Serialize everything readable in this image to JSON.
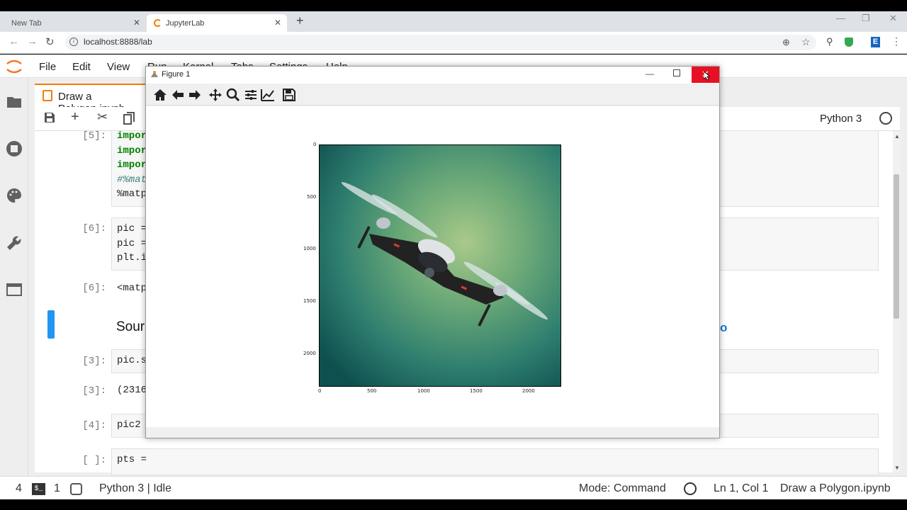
{
  "browser": {
    "tabs": [
      {
        "label": "New Tab",
        "close": "✕"
      },
      {
        "label": "JupyterLab",
        "close": "✕"
      }
    ],
    "new_tab": "+",
    "url": "localhost:8888/lab",
    "win_min": "—",
    "win_max": "❐",
    "win_close": "✕"
  },
  "menubar": {
    "items": [
      "File",
      "Edit",
      "View",
      "Run",
      "Kernel",
      "Tabs",
      "Settings",
      "Help"
    ]
  },
  "doc_tab": {
    "label": "Draw a Polygon.ipynb"
  },
  "toolbar": {
    "kernel": "Python 3"
  },
  "cells": [
    {
      "prompt": "[5]:",
      "lines": [
        "import",
        "import",
        "import",
        "#%mat",
        "%matp"
      ]
    },
    {
      "prompt": "[6]:",
      "lines": [
        "pic =",
        "pic =",
        "plt.i"
      ]
    },
    {
      "prompt": "[6]:",
      "output": "<matp"
    },
    {
      "markdown": "Sour",
      "link": "o"
    },
    {
      "prompt": "[3]:",
      "lines": [
        "pic.s"
      ]
    },
    {
      "prompt": "[3]:",
      "output": "(2316"
    },
    {
      "prompt": "[4]:",
      "lines": [
        "pic2"
      ]
    },
    {
      "prompt": "[ ]:",
      "lines": [
        "pts ="
      ]
    }
  ],
  "status": {
    "num1": "4",
    "num2": "1",
    "kernel_state": "Python 3 | Idle",
    "mode": "Mode: Command",
    "cursor": "Ln 1, Col 1",
    "file": "Draw a Polygon.ipynb"
  },
  "figure": {
    "title": "Figure 1",
    "x_ticks": [
      "0",
      "500",
      "1000",
      "1500",
      "2000"
    ],
    "y_ticks": [
      "0",
      "500",
      "1000",
      "1500",
      "2000"
    ]
  }
}
